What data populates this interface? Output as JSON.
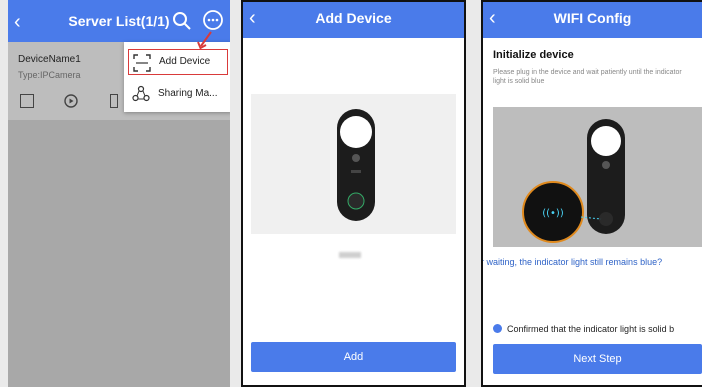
{
  "phone1": {
    "title": "Server List(1/1)",
    "device_name": "DeviceName1",
    "device_type": "Type:IPCamera",
    "menu": {
      "add_device": "Add Device",
      "sharing": "Sharing Ma..."
    }
  },
  "phone2": {
    "title": "Add Device",
    "add_button": "Add"
  },
  "phone3": {
    "title": "WIFI Config",
    "heading": "Initialize device",
    "instruction": "Please plug in the device and wait patiently until the indicator light is solid blue",
    "waiting_link": "r waiting, the indicator light still remains blue?",
    "confirm_text": "Confirmed that the indicator light is solid b",
    "next_button": "Next Step"
  },
  "colors": {
    "accent": "#4a7bea",
    "highlight": "#d93a3a"
  }
}
